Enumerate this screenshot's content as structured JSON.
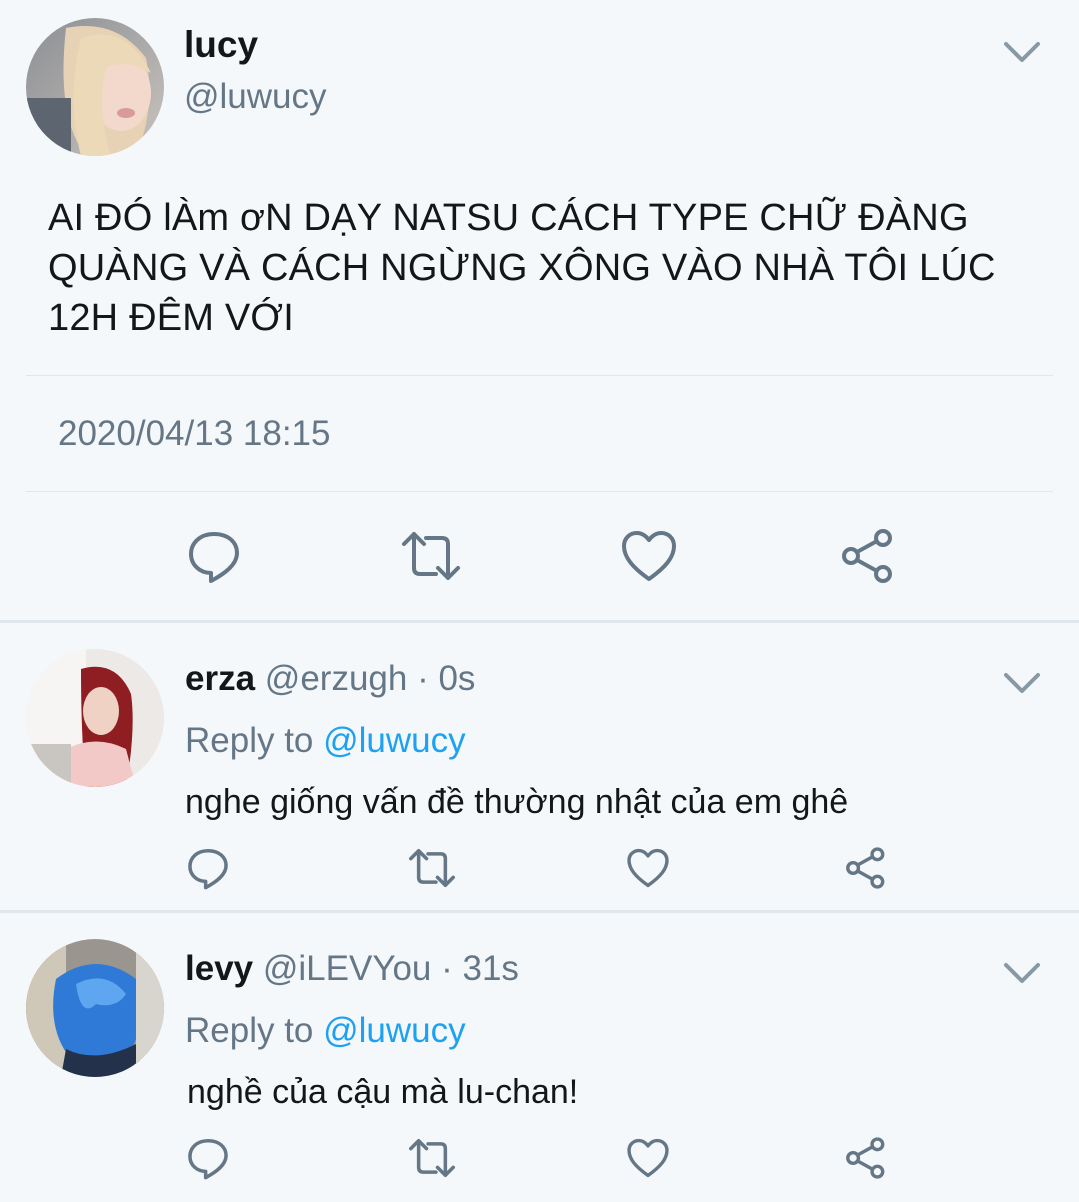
{
  "main_tweet": {
    "name": "lucy",
    "handle": "@luwucy",
    "text": "AI ĐÓ lÀm ơN DẠY NATSU CÁCH TYPE CHỮ ĐÀNG QUÀNG VÀ CÁCH NGỪNG XÔNG VÀO NHÀ TÔI LÚC 12H ĐÊM VỚI",
    "timestamp": "2020/04/13 18:15",
    "actions": [
      "reply-icon",
      "retweet-icon",
      "like-icon",
      "share-icon"
    ]
  },
  "replies": [
    {
      "name": "erza",
      "handle": "@erzugh",
      "meta": " · 0s",
      "reply_to_label": "Reply to ",
      "reply_to_mention": "@luwucy",
      "text": "nghe giống vấn đề thường nhật của em ghê"
    },
    {
      "name": "levy",
      "handle": "@iLEVYou",
      "meta": " · 31s",
      "reply_to_label": "Reply to ",
      "reply_to_mention": "@luwucy",
      "text": "nghề của cậu mà lu-chan!"
    }
  ],
  "colors": {
    "background": "#f5f8fa",
    "text": "#14171a",
    "secondary": "#657786",
    "link": "#1da1f2",
    "divider": "#e1e8ed"
  }
}
